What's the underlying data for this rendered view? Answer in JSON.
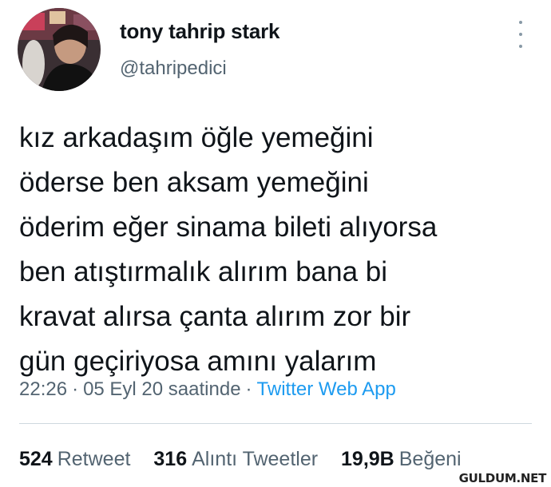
{
  "user": {
    "display_name": "tony tahrip stark",
    "handle": "@tahripedici",
    "avatar_icon": "profile-photo"
  },
  "menu_icon": "more-vertical-icon",
  "tweet": {
    "lines": [
      "kız arkadaşım öğle yemeğini",
      "öderse ben aksam yemeğini",
      "öderim eğer sinama bileti alıyorsa",
      "ben atıştırmalık alırım bana bi",
      "kravat alırsa çanta alırım zor bir",
      "gün geçiriyosa amını yalarım"
    ]
  },
  "meta": {
    "time": "22:26",
    "date": "05 Eyl 20 saatinde",
    "separator": "·",
    "source": "Twitter Web App"
  },
  "stats": {
    "retweets": {
      "count": "524",
      "label": "Retweet"
    },
    "quotes": {
      "count": "316",
      "label": "Alıntı Tweetler"
    },
    "likes": {
      "count": "19,9B",
      "label": "Beğeni"
    }
  },
  "watermark": "GULDUM.NET",
  "colors": {
    "text": "#0f1419",
    "secondary": "#536471",
    "link": "#1d9bf0",
    "divider": "#cfd9de"
  }
}
